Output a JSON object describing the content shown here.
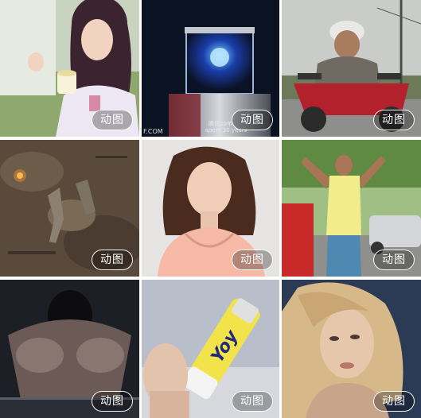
{
  "gallery": {
    "badge_label": "动图",
    "tiles": [
      {
        "name": "girl-eating",
        "badge": "动图"
      },
      {
        "name": "glowing-device",
        "badge": "动图",
        "caption_line1": "腾讯30年",
        "caption_line2": "spent 30 years",
        "watermark": "F.COM"
      },
      {
        "name": "man-on-scooter",
        "badge": "动图"
      },
      {
        "name": "battlefield-figures",
        "badge": "动图"
      },
      {
        "name": "woman-looking-down",
        "badge": "动图"
      },
      {
        "name": "dancing-man",
        "badge": "动图"
      },
      {
        "name": "muscular-man",
        "badge": "动图"
      },
      {
        "name": "tube-product",
        "badge": "动图",
        "brand_text": "Yoy"
      },
      {
        "name": "blonde-woman",
        "badge": "动图"
      }
    ]
  },
  "colors": {
    "background": "#ffffff",
    "badge_border": "#ffffff",
    "badge_text": "#ffffff"
  }
}
